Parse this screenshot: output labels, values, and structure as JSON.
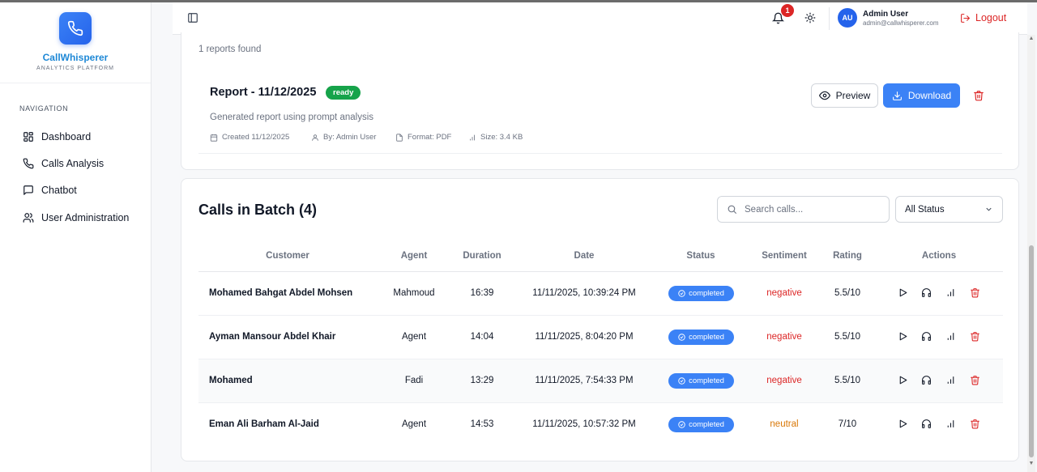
{
  "sidebar": {
    "brand_name": "CallWhisperer",
    "brand_sub": "ANALYTICS PLATFORM",
    "nav_title": "NAVIGATION",
    "items": [
      {
        "label": "Dashboard",
        "icon": "dashboard-icon"
      },
      {
        "label": "Calls Analysis",
        "icon": "phone-icon"
      },
      {
        "label": "Chatbot",
        "icon": "chat-icon"
      },
      {
        "label": "User Administration",
        "icon": "users-icon"
      }
    ]
  },
  "header": {
    "notification_count": "1",
    "user_initials": "AU",
    "user_name": "Admin User",
    "user_email": "admin@callwhisperer.com",
    "logout_label": "Logout"
  },
  "reports": {
    "found_text": "1 reports found",
    "item": {
      "title": "Report - 11/12/2025",
      "status": "ready",
      "description": "Generated report using prompt analysis",
      "created": "Created 11/12/2025",
      "by": "By: Admin User",
      "format": "Format: PDF",
      "size": "Size: 3.4 KB",
      "preview_label": "Preview",
      "download_label": "Download"
    }
  },
  "calls": {
    "title": "Calls in Batch (4)",
    "search_placeholder": "Search calls...",
    "status_filter": "All Status",
    "columns": [
      "Customer",
      "Agent",
      "Duration",
      "Date",
      "Status",
      "Sentiment",
      "Rating",
      "Actions"
    ],
    "rows": [
      {
        "customer": "Mohamed Bahgat Abdel Mohsen",
        "agent": "Mahmoud",
        "duration": "16:39",
        "date": "11/11/2025, 10:39:24 PM",
        "status": "completed",
        "sentiment": "negative",
        "rating": "5.5/10"
      },
      {
        "customer": "Ayman Mansour Abdel Khair",
        "agent": "Agent",
        "duration": "14:04",
        "date": "11/11/2025, 8:04:20 PM",
        "status": "completed",
        "sentiment": "negative",
        "rating": "5.5/10"
      },
      {
        "customer": "Mohamed",
        "agent": "Fadi",
        "duration": "13:29",
        "date": "11/11/2025, 7:54:33 PM",
        "status": "completed",
        "sentiment": "negative",
        "rating": "5.5/10"
      },
      {
        "customer": "Eman Ali Barham Al-Jaid",
        "agent": "Agent",
        "duration": "14:53",
        "date": "11/11/2025, 10:57:32 PM",
        "status": "completed",
        "sentiment": "neutral",
        "rating": "7/10"
      }
    ]
  },
  "colors": {
    "primary": "#3b82f6",
    "brand_text": "#1e88d6",
    "danger": "#dc2626",
    "success": "#16a34a",
    "neutral_sentiment": "#d97706"
  }
}
